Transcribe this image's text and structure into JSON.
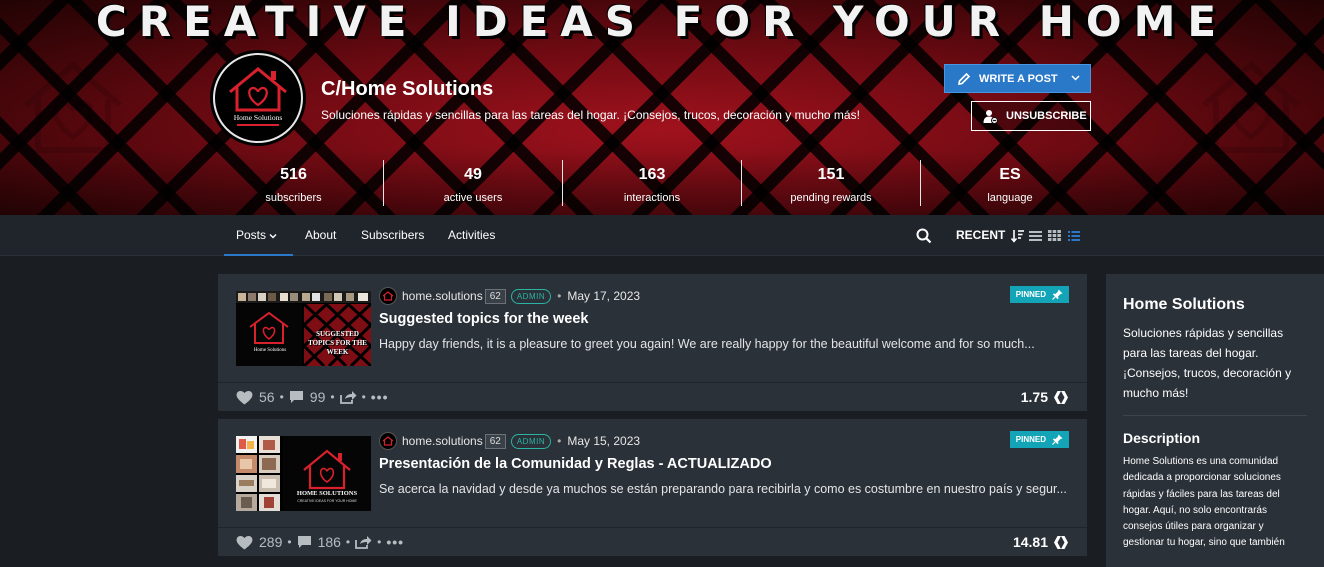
{
  "banner": {
    "title": "CREATIVE IDEAS FOR YOUR HOME",
    "avatar_text": "Home Solutions"
  },
  "community": {
    "name": "C/Home Solutions",
    "tagline": "Soluciones rápidas y sencillas para las tareas del hogar. ¡Consejos, trucos, decoración y mucho más!"
  },
  "actions": {
    "write_post": "WRITE A POST",
    "unsubscribe": "UNSUBSCRIBE"
  },
  "stats": [
    {
      "value": "516",
      "label": "subscribers"
    },
    {
      "value": "49",
      "label": "active users"
    },
    {
      "value": "163",
      "label": "interactions"
    },
    {
      "value": "151",
      "label": "pending rewards"
    },
    {
      "value": "ES",
      "label": "language"
    }
  ],
  "nav": {
    "tabs": [
      "Posts",
      "About",
      "Subscribers",
      "Activities"
    ],
    "sort": "RECENT"
  },
  "posts": [
    {
      "author": "home.solutions",
      "reputation": "62",
      "role": "ADMIN",
      "date": "May 17, 2023",
      "badge": "PINNED",
      "title": "Suggested topics for the week",
      "excerpt": "Happy day friends, it is a pleasure to greet you again! We are really happy for the beautiful welcome and for so much...",
      "thumb_logo_text": "Home Solutions",
      "thumb_caption": "SUGGESTED TOPICS FOR THE WEEK",
      "votes": "56",
      "comments": "99",
      "payout": "1.75"
    },
    {
      "author": "home.solutions",
      "reputation": "62",
      "role": "ADMIN",
      "date": "May 15, 2023",
      "badge": "PINNED",
      "title": "Presentación de la Comunidad y Reglas - ACTUALIZADO",
      "excerpt": "Se acerca la navidad y desde ya muchos se están preparando para recibirla y como es costumbre en nuestro país y segur...",
      "thumb_logo_text": "HOME SOLUTIONS",
      "thumb_caption": "CREATIVE IDEAS FOR YOUR HOME",
      "votes": "289",
      "comments": "186",
      "payout": "14.81"
    }
  ],
  "sidebar": {
    "title": "Home Solutions",
    "about": "Soluciones rápidas y sencillas para las tareas del hogar. ¡Consejos, trucos, decoración y mucho más!",
    "description_title": "Description",
    "description": "Home Solutions es una comunidad dedicada a proporcionar soluciones rápidas y fáciles para las tareas del hogar. Aquí, no solo encontrarás consejos útiles para organizar y gestionar tu hogar, sino que también"
  },
  "colors": {
    "accent_blue": "#2a79c9",
    "pinned_teal": "#14a4b8",
    "admin_teal": "#2bb3a3",
    "banner_red": "#a0121d",
    "card_bg": "#2b3138"
  }
}
